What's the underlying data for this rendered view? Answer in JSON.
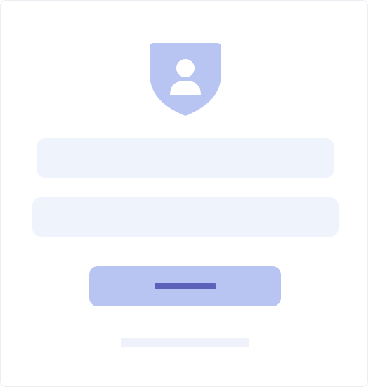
{
  "logo": {
    "icon": "shield-user-icon",
    "color": "#b8c4f1",
    "glyph_color": "#ffffff"
  },
  "form": {
    "username_field": {
      "value": "",
      "placeholder": ""
    },
    "password_field": {
      "value": "",
      "placeholder": ""
    },
    "submit_button": {
      "label": ""
    },
    "footer_link": {
      "label": ""
    }
  },
  "colors": {
    "card_border": "#ececf2",
    "field_background": "#eff3fb",
    "button_background": "#b8c4f1",
    "button_text_placeholder": "#5b62b9",
    "link_placeholder": "#eff1fb"
  }
}
